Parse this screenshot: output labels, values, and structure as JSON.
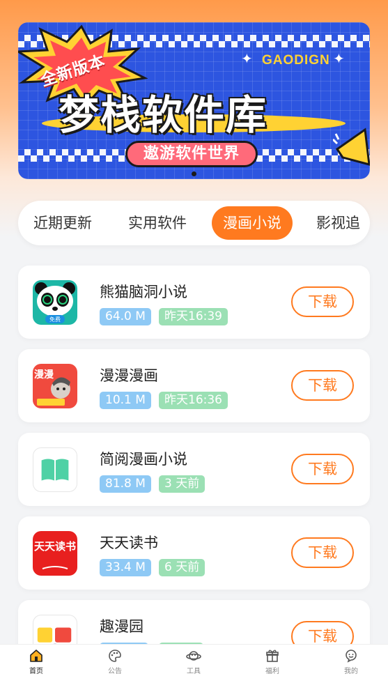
{
  "banner": {
    "burst_text": "全新版本",
    "brand": "GAODIGN",
    "title": "梦栈软件库",
    "subtitle": "遨游软件世界",
    "colors": {
      "background": "#2d55e0",
      "accent": "#ffd233",
      "pill": "#ff6a7a"
    }
  },
  "tabs": [
    {
      "label": "近期更新",
      "active": false
    },
    {
      "label": "实用软件",
      "active": false
    },
    {
      "label": "漫画小说",
      "active": true
    },
    {
      "label": "影视追",
      "active": false
    }
  ],
  "apps": [
    {
      "name": "熊猫脑洞小说",
      "size": "64.0 M",
      "updated": "昨天16:39",
      "download_label": "下载",
      "icon": "panda-icon",
      "icon_text": "免费"
    },
    {
      "name": "漫漫漫画",
      "size": "10.1 M",
      "updated": "昨天16:36",
      "download_label": "下载",
      "icon": "manman-icon",
      "icon_text": "漫漫"
    },
    {
      "name": "简阅漫画小说",
      "size": "81.8 M",
      "updated": "3 天前",
      "download_label": "下载",
      "icon": "book-icon"
    },
    {
      "name": "天天读书",
      "size": "33.4 M",
      "updated": "6 天前",
      "download_label": "下载",
      "icon": "tiantian-icon",
      "icon_text": "天天读书"
    },
    {
      "name": "趣漫园",
      "size": "",
      "updated": "",
      "download_label": "下载",
      "icon": "qumanyuan-icon"
    }
  ],
  "nav": [
    {
      "label": "首页",
      "icon": "home-icon",
      "active": true
    },
    {
      "label": "公告",
      "icon": "palette-icon",
      "active": false
    },
    {
      "label": "工具",
      "icon": "planet-icon",
      "active": false
    },
    {
      "label": "福利",
      "icon": "gift-icon",
      "active": false
    },
    {
      "label": "我的",
      "icon": "profile-icon",
      "active": false
    }
  ],
  "colors": {
    "accent": "#ff7a1f",
    "size_badge": "#8ec9f5",
    "time_badge": "#9be0b4"
  }
}
